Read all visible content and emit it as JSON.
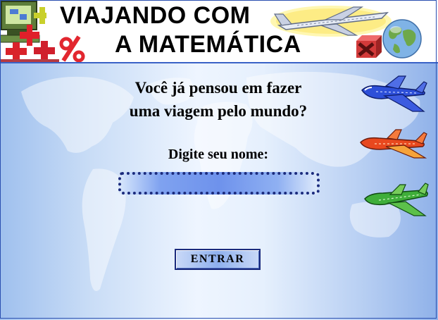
{
  "header": {
    "title_line1": "VIAJANDO COM",
    "title_line2": "A MATEMÁTICA"
  },
  "main": {
    "question_line1": "Você já pensou em fazer",
    "question_line2": "uma viagem pelo mundo?",
    "name_prompt": "Digite seu nome:",
    "name_input_value": "",
    "enter_label": "ENTRAR"
  },
  "icons": {
    "header_left": "computer-math-clipart-icon",
    "header_airplane": "airplane-icon",
    "header_cross": "red-x-icon",
    "header_globe": "globe-icon",
    "plane_1": "blue-airplane-icon",
    "plane_2": "red-airplane-icon",
    "plane_3": "green-airplane-icon"
  },
  "colors": {
    "header_border": "#3a62c7",
    "input_border": "#1b2b7d",
    "plane_blue": "#2d4fd8",
    "plane_red": "#e8481e",
    "plane_green": "#3fae3a"
  }
}
